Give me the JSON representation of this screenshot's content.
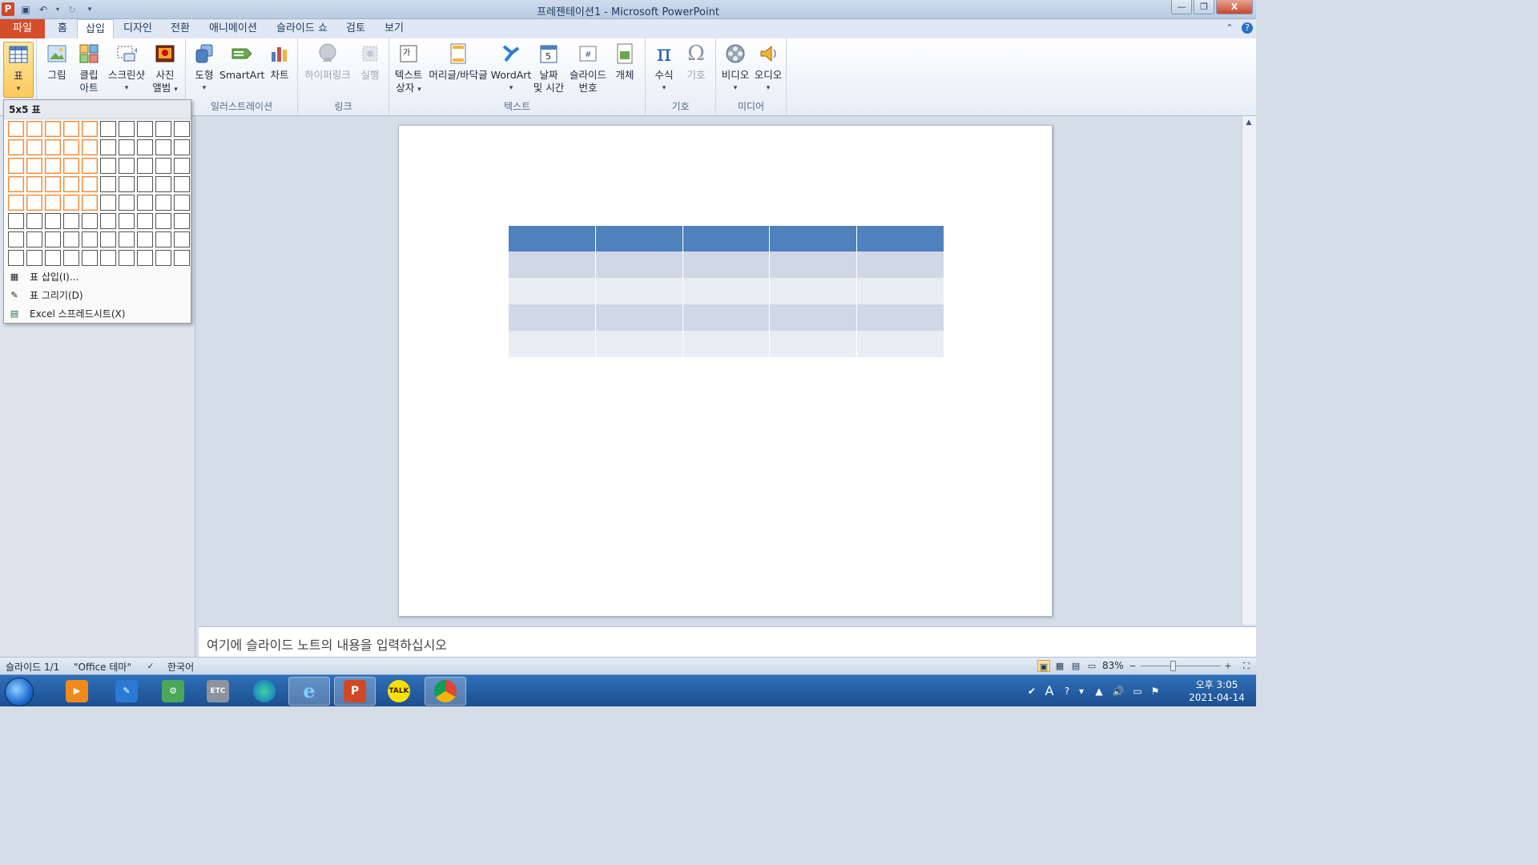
{
  "window": {
    "title": "프레젠테이션1  -  Microsoft PowerPoint",
    "app_icon_letter": "P",
    "controls": {
      "minimize": "—",
      "restore": "❐",
      "close": "X"
    }
  },
  "qat": {
    "save_icon": "save-icon",
    "undo_icon": "undo-icon",
    "redo_icon": "redo-icon",
    "customize_icon": "customize-qat-icon"
  },
  "tabs": [
    {
      "label": "파일"
    },
    {
      "label": "홈"
    },
    {
      "label": "삽입"
    },
    {
      "label": "디자인"
    },
    {
      "label": "전환"
    },
    {
      "label": "애니메이션"
    },
    {
      "label": "슬라이드 쇼"
    },
    {
      "label": "검토"
    },
    {
      "label": "보기"
    }
  ],
  "active_tab": "삽입",
  "ribbon": {
    "groups": {
      "illustrations": "일러스트레이션",
      "links": "링크",
      "text": "텍스트",
      "symbols": "기호",
      "media": "미디어"
    },
    "buttons": {
      "table": "표",
      "picture": "그림",
      "clipart_1": "클립",
      "clipart_2": "아트",
      "screenshot": "스크린샷",
      "album_1": "사진",
      "album_2": "앨범",
      "shapes": "도형",
      "smartart": "SmartArt",
      "chart": "차트",
      "hyperlink": "하이퍼링크",
      "action": "실행",
      "textbox_1": "텍스트",
      "textbox_2": "상자",
      "header_footer": "머리글/바닥글",
      "wordart": "WordArt",
      "datetime_1": "날짜",
      "datetime_2": "및 시간",
      "slidenum_1": "슬라이드",
      "slidenum_2": "번호",
      "object": "개체",
      "equation": "수식",
      "symbol": "기호",
      "video": "비디오",
      "audio": "오디오"
    }
  },
  "table_dropdown": {
    "header": "5x5 표",
    "grid_cols": 10,
    "grid_rows": 8,
    "selected_cols": 5,
    "selected_rows": 5,
    "items": [
      {
        "label": "표 삽입(I)...",
        "icon": "insert-table-icon"
      },
      {
        "label": "표 그리기(D)",
        "icon": "draw-table-icon"
      },
      {
        "label": "Excel 스프레드시트(X)",
        "icon": "excel-sheet-icon"
      }
    ]
  },
  "slide": {
    "table": {
      "rows": 5,
      "cols": 5,
      "header_color": "#4f81bd",
      "band_odd": "#d0d8e8",
      "band_even": "#e9edf4"
    }
  },
  "notes": {
    "placeholder": "여기에 슬라이드 노트의 내용을 입력하십시오"
  },
  "status": {
    "slide": "슬라이드 1/1",
    "theme": "\"Office 테마\"",
    "language": "한국어",
    "zoom": "83%",
    "zoom_minus": "−",
    "zoom_plus": "+"
  },
  "taskbar": {
    "apps": [
      {
        "name": "media-player-app"
      },
      {
        "name": "chat-app"
      },
      {
        "name": "tools-app"
      },
      {
        "name": "etc-app",
        "label": "ETC"
      },
      {
        "name": "edge-app"
      },
      {
        "name": "ie-app",
        "label": "e"
      },
      {
        "name": "powerpoint-app",
        "label": "P"
      },
      {
        "name": "kakaotalk-app",
        "label": "TALK"
      },
      {
        "name": "chrome-app"
      }
    ],
    "clock_time": "오후 3:05",
    "clock_date": "2021-04-14",
    "ime_label": "A"
  }
}
